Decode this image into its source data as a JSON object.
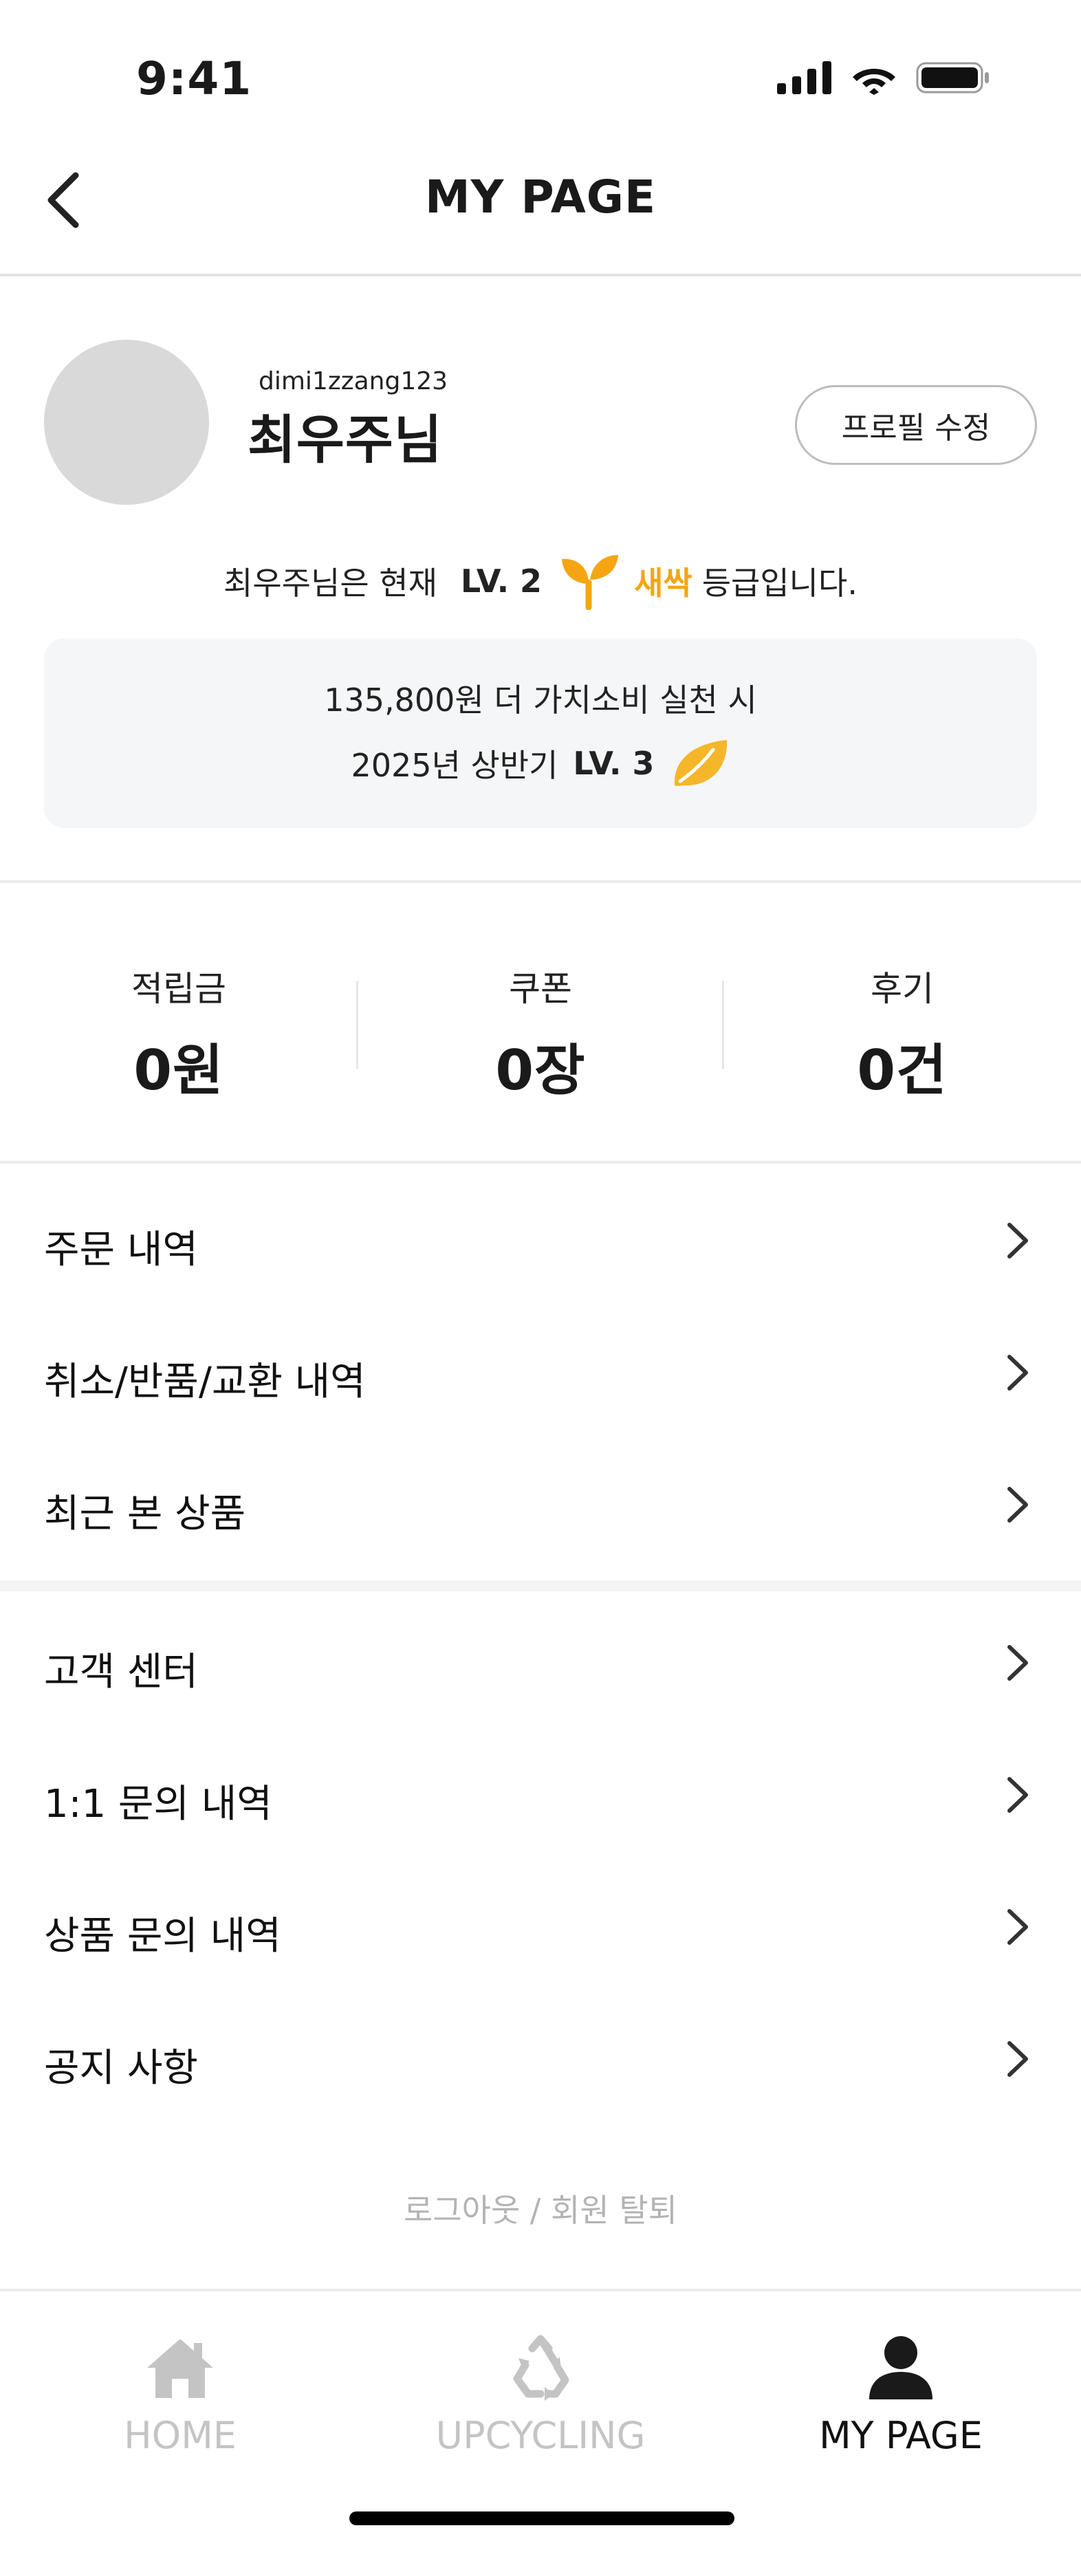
{
  "status_bar": {
    "time": "9:41"
  },
  "header": {
    "title": "MY PAGE"
  },
  "profile": {
    "user_id": "dimi1zzang123",
    "name": "최우주님",
    "edit_button": "프로필 수정",
    "level_prefix": "최우주님은 현재",
    "level": "LV. 2",
    "grade": "새싹",
    "level_suffix": "등급입니다.",
    "grade_color": "#F5A512",
    "next_level": {
      "line1": "135,800원 더 가치소비 실천 시",
      "line2_prefix": "2025년 상반기",
      "level": "LV. 3"
    }
  },
  "stats": [
    {
      "label": "적립금",
      "value": "0원"
    },
    {
      "label": "쿠폰",
      "value": "0장"
    },
    {
      "label": "후기",
      "value": "0건"
    }
  ],
  "menu_group_1": [
    {
      "label": "주문 내역"
    },
    {
      "label": "취소/반품/교환 내역"
    },
    {
      "label": "최근 본 상품"
    }
  ],
  "menu_group_2": [
    {
      "label": "고객 센터"
    },
    {
      "label": "1:1 문의 내역"
    },
    {
      "label": "상품 문의 내역"
    },
    {
      "label": "공지 사항"
    }
  ],
  "footer": {
    "logout_text": "로그아웃 / 회원 탈퇴"
  },
  "tab_bar": {
    "tabs": [
      {
        "label": "HOME",
        "icon": "home-icon",
        "active": false
      },
      {
        "label": "UPCYCLING",
        "icon": "recycle-icon",
        "active": false
      },
      {
        "label": "MY PAGE",
        "icon": "person-icon",
        "active": true
      }
    ]
  }
}
